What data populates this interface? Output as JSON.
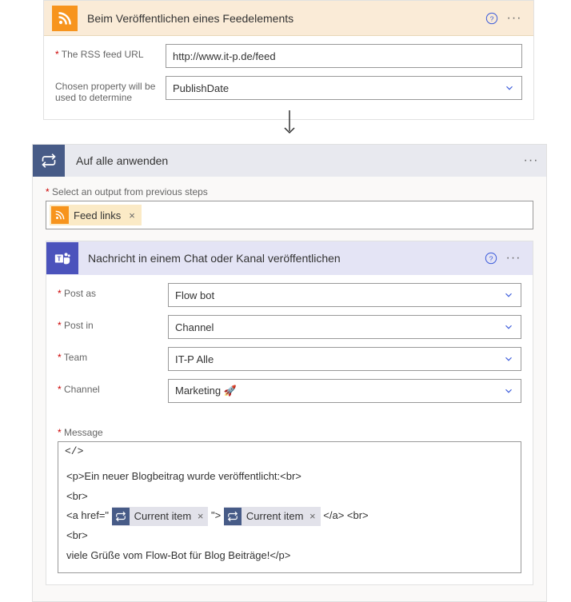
{
  "rss": {
    "title": "Beim Veröffentlichen eines Feedelements",
    "url_label": "The RSS feed URL",
    "url_value": "http://www.it-p.de/feed",
    "prop_label": "Chosen property will be used to determine",
    "prop_value": "PublishDate"
  },
  "foreach": {
    "title": "Auf alle anwenden",
    "select_label": "Select an output from previous steps",
    "token": "Feed links"
  },
  "teams": {
    "title": "Nachricht in einem Chat oder Kanal veröffentlichen",
    "post_as_label": "Post as",
    "post_as_value": "Flow bot",
    "post_in_label": "Post in",
    "post_in_value": "Channel",
    "team_label": "Team",
    "team_value": "IT-P Alle",
    "channel_label": "Channel",
    "channel_value": "Marketing 🚀",
    "message_label": "Message",
    "toolbar": "</>",
    "msg_line1": "<p>Ein neuer Blogbeitrag wurde veröffentlicht:<br>",
    "msg_br": "<br>",
    "msg_a1": "<a href=\"",
    "msg_a2": "\">",
    "msg_a3": " </a>  <br>",
    "token": "Current item",
    "msg_end": "viele Grüße vom Flow-Bot für Blog Beiträge!</p>"
  }
}
